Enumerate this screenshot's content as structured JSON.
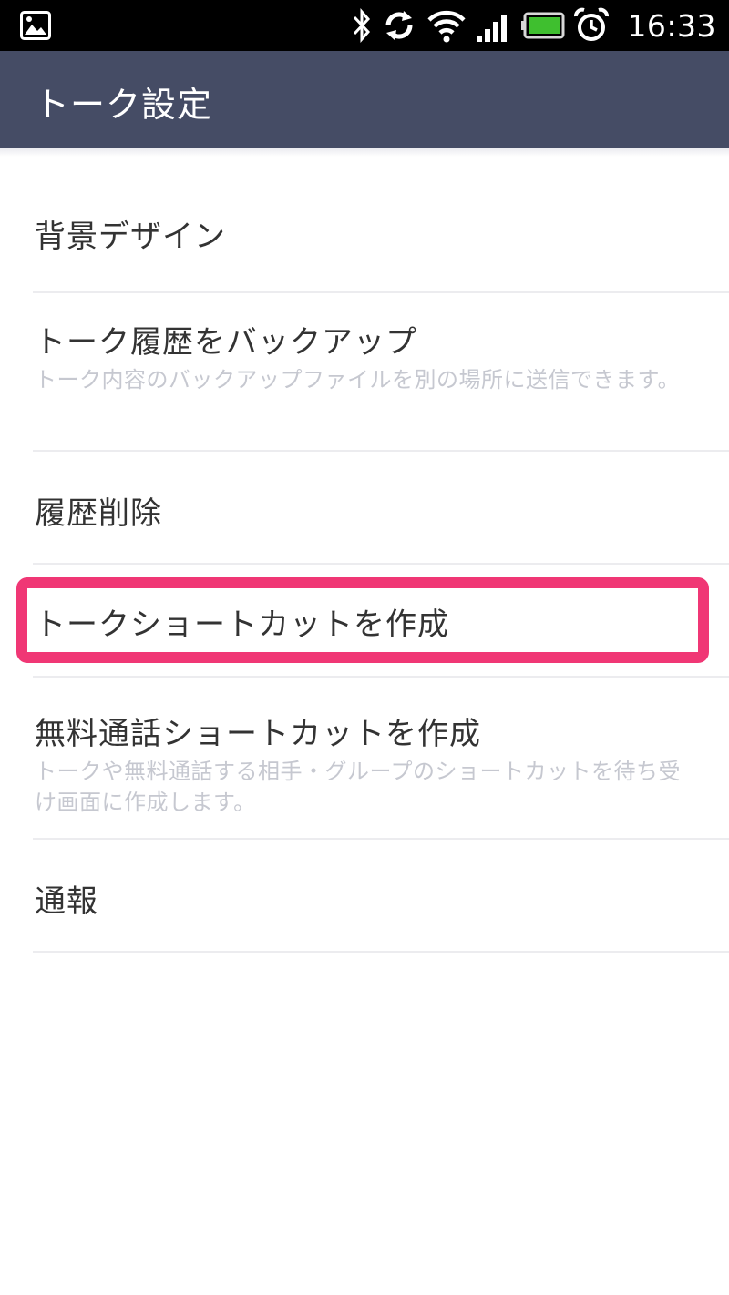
{
  "status_bar": {
    "time": "16:33",
    "icons": [
      "gallery-icon",
      "bluetooth-icon",
      "sync-icon",
      "wifi-icon",
      "signal-icon",
      "battery-icon",
      "alarm-icon"
    ],
    "battery_color": "#3fbf2f"
  },
  "header": {
    "title": "トーク設定",
    "background_color": "#454c65"
  },
  "settings": {
    "items": [
      {
        "title": "背景デザイン",
        "subtitle": ""
      },
      {
        "title": "トーク履歴をバックアップ",
        "subtitle": "トーク内容のバックアップファイルを別の場所に送信できます。"
      },
      {
        "title": "履歴削除",
        "subtitle": ""
      },
      {
        "title": "トークショートカットを作成",
        "subtitle": "",
        "highlighted": true
      },
      {
        "title": "無料通話ショートカットを作成",
        "subtitle": "トークや無料通話する相手・グループのショートカットを待ち受け画面に作成します。"
      },
      {
        "title": "通報",
        "subtitle": ""
      }
    ]
  },
  "highlight_color": "#f03775"
}
